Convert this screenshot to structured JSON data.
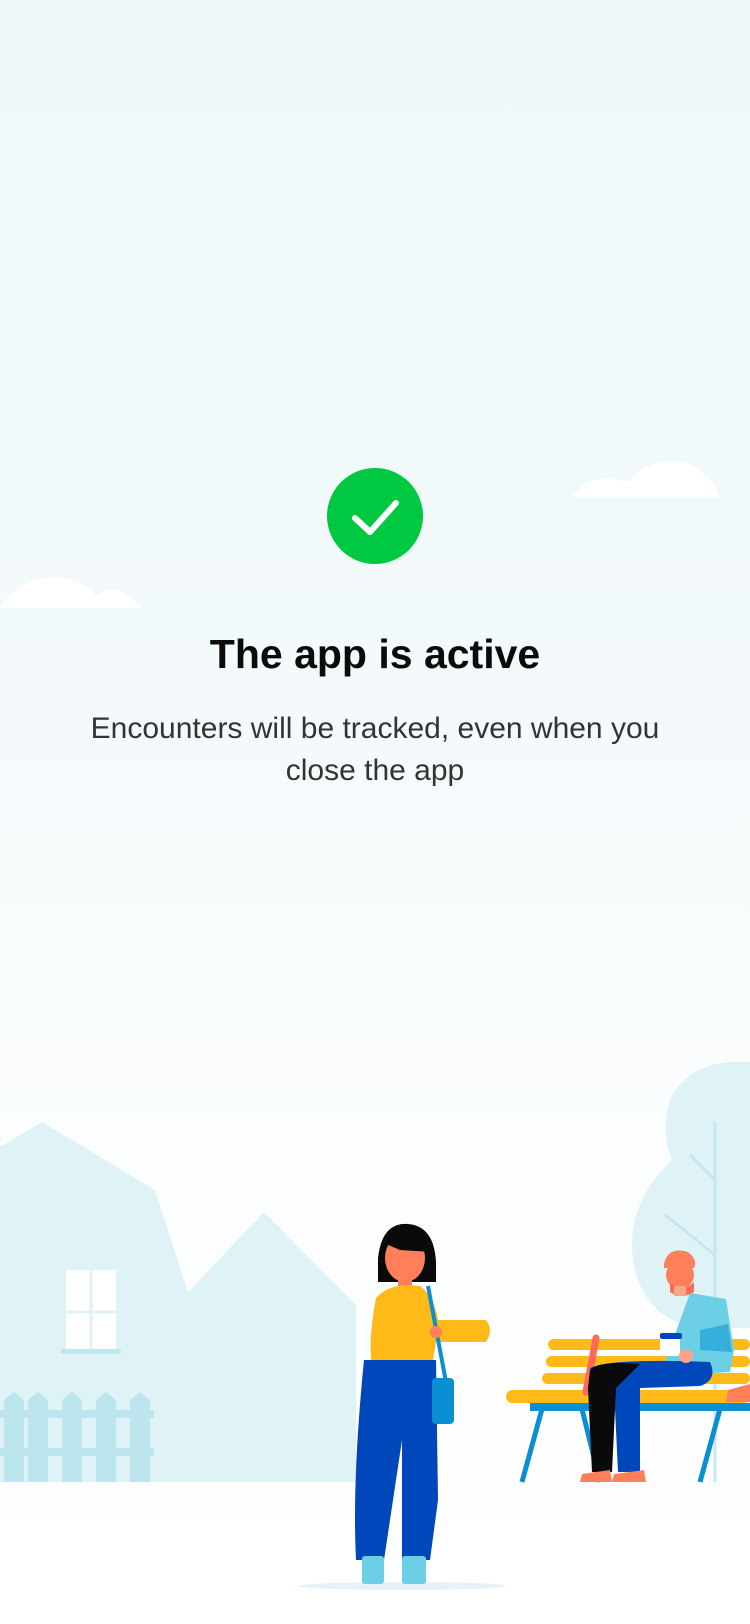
{
  "status": {
    "title": "The app is active",
    "description": "Encounters will be tracked, even when you close the app",
    "icon": "checkmark-icon",
    "state": "active"
  },
  "colors": {
    "accent_green": "#00C840",
    "background_tint": "#EEF7F9",
    "scenery": "#DDF1F6",
    "title_text": "#0B0B0B",
    "body_text": "#333333"
  }
}
